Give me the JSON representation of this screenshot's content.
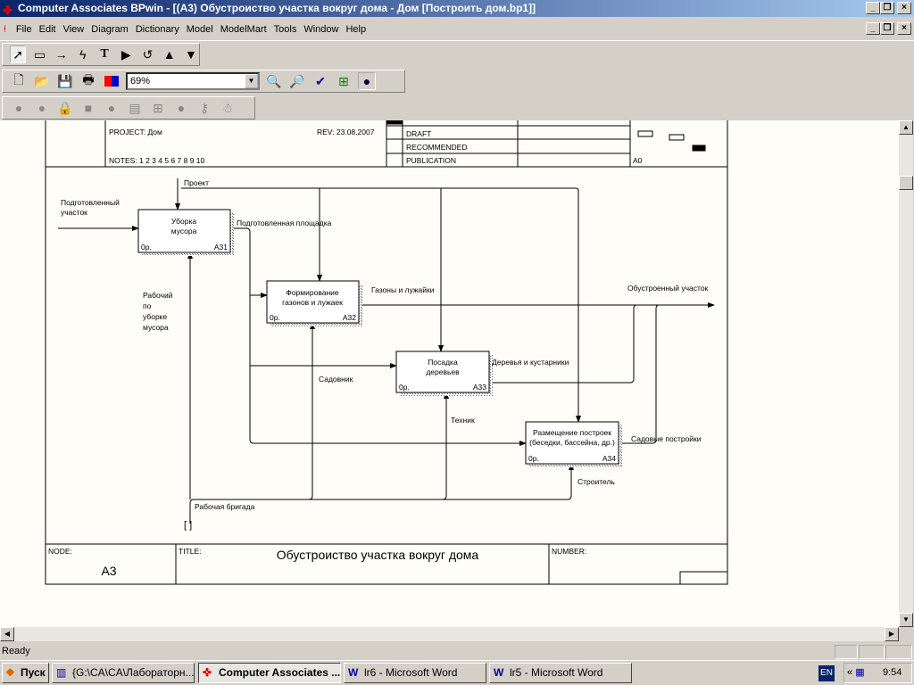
{
  "window": {
    "title": "Computer Associates BPwin - [(A3) Обустроиство  участка  вокруг дома - Дом  [Построить дом.bp1]]"
  },
  "menu": [
    "File",
    "Edit",
    "View",
    "Diagram",
    "Dictionary",
    "Model",
    "ModelMart",
    "Tools",
    "Window",
    "Help"
  ],
  "toolbar": {
    "zoom_value": "69%"
  },
  "header": {
    "project": "PROJECT:  Дом",
    "rev": "REV:  23.08.2007",
    "notes": "NOTES:  1  2  3  4  5  6  7  8  9  10",
    "draft": "DRAFT",
    "recommended": "RECOMMENDED",
    "publication": "PUBLICATION",
    "context": "A0"
  },
  "boxes": [
    {
      "title1": "Уборка",
      "title2": "мусора",
      "cost": "0р.",
      "id": "A31"
    },
    {
      "title1": "Формирование",
      "title2": "газонов  и  лужаек",
      "cost": "0р.",
      "id": "A32"
    },
    {
      "title1": "Посадка",
      "title2": "деревьев",
      "cost": "0р.",
      "id": "A33"
    },
    {
      "title1": "Размещение построек",
      "title2": "(беседки, бассейна, др.)",
      "cost": "0р.",
      "id": "A34"
    }
  ],
  "arrows": {
    "input1": "Подготовленный",
    "input2": "участок",
    "control": "Проект",
    "out1": "Подготовленная площадка",
    "out2": "Газоны и лужайки",
    "out3": "Деревья и кустарники",
    "out4": "Садовые постройки",
    "final": "Обустроенный  участок",
    "mech_a": "Рабочий",
    "mech_b": "по",
    "mech_c": "уборке",
    "mech_d": "мусора",
    "mech2": "Садовник",
    "mech3": "Техник",
    "mech4": "Строитель",
    "mech_all": "Рабочая бригада",
    "tunnel": "[ ]"
  },
  "footer": {
    "node_label": "NODE:",
    "node": "A3",
    "title_label": "TITLE:",
    "title": "Обустроиство  участка  вокруг дома",
    "number_label": "NUMBER:"
  },
  "status": {
    "text": "Ready"
  },
  "taskbar": {
    "start": "Пуск",
    "tasks": [
      "{G:\\CA\\CA\\Лабораторн...",
      "Computer Associates ...",
      "lr6 - Microsoft Word",
      "lr5 - Microsoft Word"
    ],
    "lang": "EN",
    "time": "9:54"
  }
}
